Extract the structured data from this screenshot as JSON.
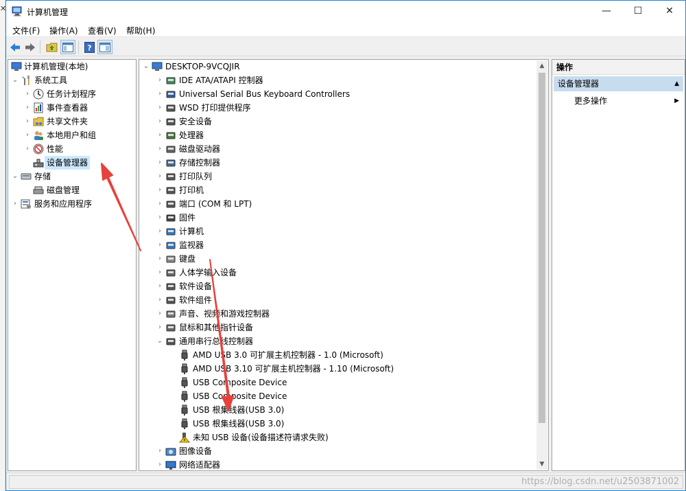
{
  "window": {
    "title": "计算机管理",
    "controls": {
      "minimize": "—",
      "maximize": "☐",
      "close": "✕"
    }
  },
  "menubar": {
    "items": [
      "文件(F)",
      "操作(A)",
      "查看(V)",
      "帮助(H)"
    ]
  },
  "toolbar": {
    "buttons": [
      "back-icon",
      "forward-icon",
      "up-folder-icon",
      "show-hide-tree-icon",
      "help-icon",
      "properties-icon"
    ]
  },
  "left_tree": {
    "root": "计算机管理(本地)",
    "items": [
      {
        "label": "系统工具",
        "expanded": true
      },
      {
        "label": "任务计划程序"
      },
      {
        "label": "事件查看器"
      },
      {
        "label": "共享文件夹"
      },
      {
        "label": "本地用户和组"
      },
      {
        "label": "性能"
      },
      {
        "label": "设备管理器",
        "selected": true
      },
      {
        "label": "存储",
        "expanded": true
      },
      {
        "label": "磁盘管理"
      },
      {
        "label": "服务和应用程序"
      }
    ]
  },
  "device_tree": {
    "root": "DESKTOP-9VCQJIR",
    "categories": [
      "IDE ATA/ATAPI 控制器",
      "Universal Serial Bus Keyboard Controllers",
      "WSD 打印提供程序",
      "安全设备",
      "处理器",
      "磁盘驱动器",
      "存储控制器",
      "打印队列",
      "打印机",
      "端口 (COM 和 LPT)",
      "固件",
      "计算机",
      "监视器",
      "键盘",
      "人体学输入设备",
      "软件设备",
      "软件组件",
      "声音、视频和游戏控制器",
      "鼠标和其他指针设备",
      "通用串行总线控制器"
    ],
    "usb_children": [
      "AMD USB 3.0 可扩展主机控制器 - 1.0 (Microsoft)",
      "AMD USB 3.10 可扩展主机控制器 - 1.10 (Microsoft)",
      "USB Composite Device",
      "USB Composite Device",
      "USB 根集线器(USB 3.0)",
      "USB 根集线器(USB 3.0)",
      "未知 USB 设备(设备描述符请求失败)"
    ],
    "after": [
      "图像设备",
      "网络适配器"
    ]
  },
  "actions": {
    "header": "操作",
    "section": "设备管理器",
    "more": "更多操作"
  },
  "watermark": "https://blog.csdn.net/u2503871002",
  "colors": {
    "arrow": "#e8403a",
    "selection": "#cce8ff",
    "section": "#c7dcef",
    "border": "#1883d7"
  }
}
